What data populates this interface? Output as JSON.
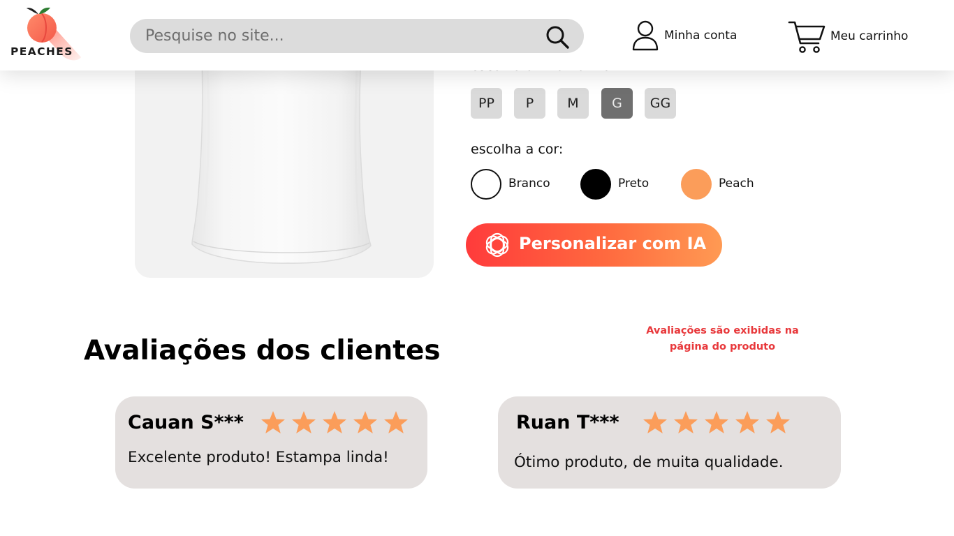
{
  "header": {
    "logo_text": "PEACHES",
    "search": {
      "placeholder": "Pesquise no site..."
    },
    "account_label": "Minha conta",
    "cart_label": "Meu carrinho"
  },
  "product": {
    "size_label": "escolha um tamanho:",
    "sizes": [
      "PP",
      "P",
      "M",
      "G",
      "GG"
    ],
    "selected_size": "G",
    "color_label": "escolha a cor:",
    "colors": [
      {
        "name": "Branco",
        "hex": "#ffffff"
      },
      {
        "name": "Preto",
        "hex": "#000000"
      },
      {
        "name": "Peach",
        "hex": "#fb9d5a"
      }
    ],
    "ai_button_label": "Personalizar com IA"
  },
  "reviews": {
    "title": "Avaliações dos clientes",
    "note": "Avaliações são exibidas na página do produto",
    "items": [
      {
        "name": "Cauan S***",
        "stars": 5,
        "text": "Excelente produto! Estampa linda!"
      },
      {
        "name": "Ruan T***",
        "stars": 5,
        "text": "Ótimo produto, de muita qualidade."
      }
    ]
  },
  "colors": {
    "accent_red": "#e8383b",
    "star": "#fb9d5a",
    "ai_gradient_start": "#ff3b3b",
    "ai_gradient_end": "#ff9a53",
    "card_bg": "#e4e0df",
    "selected_size_bg": "#6f6f6f"
  }
}
